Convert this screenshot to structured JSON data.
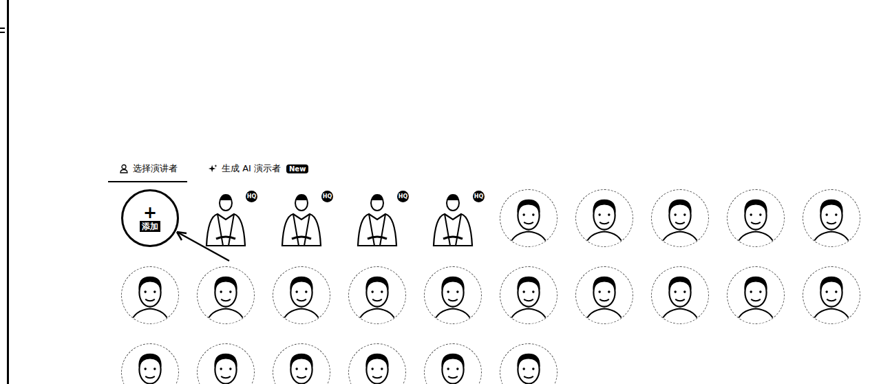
{
  "tabs": [
    {
      "label": "选择演讲者",
      "kind": "choose",
      "selected": true
    },
    {
      "label": "生成 AI 演示者",
      "kind": "generate",
      "selected": false,
      "badge": "New"
    }
  ],
  "add_button": {
    "icon": "+",
    "label": "添加"
  },
  "presenters": [
    {
      "kind": "half-body",
      "badge": "HQ"
    },
    {
      "kind": "half-body",
      "badge": "HQ"
    },
    {
      "kind": "half-body",
      "badge": "HQ"
    },
    {
      "kind": "half-body",
      "badge": "HQ"
    },
    {
      "kind": "portrait",
      "badge": ""
    },
    {
      "kind": "portrait",
      "badge": ""
    },
    {
      "kind": "portrait",
      "badge": ""
    },
    {
      "kind": "portrait",
      "badge": ""
    },
    {
      "kind": "portrait",
      "badge": ""
    },
    {
      "kind": "portrait",
      "badge": ""
    },
    {
      "kind": "portrait",
      "badge": ""
    },
    {
      "kind": "portrait",
      "badge": ""
    },
    {
      "kind": "portrait",
      "badge": ""
    },
    {
      "kind": "portrait",
      "badge": ""
    },
    {
      "kind": "portrait",
      "badge": ""
    },
    {
      "kind": "portrait",
      "badge": ""
    },
    {
      "kind": "portrait",
      "badge": ""
    },
    {
      "kind": "portrait",
      "badge": ""
    },
    {
      "kind": "portrait",
      "badge": ""
    },
    {
      "kind": "portrait",
      "badge": ""
    },
    {
      "kind": "portrait",
      "badge": ""
    },
    {
      "kind": "portrait",
      "badge": ""
    },
    {
      "kind": "portrait",
      "badge": ""
    },
    {
      "kind": "portrait",
      "badge": ""
    },
    {
      "kind": "portrait",
      "badge": ""
    }
  ]
}
